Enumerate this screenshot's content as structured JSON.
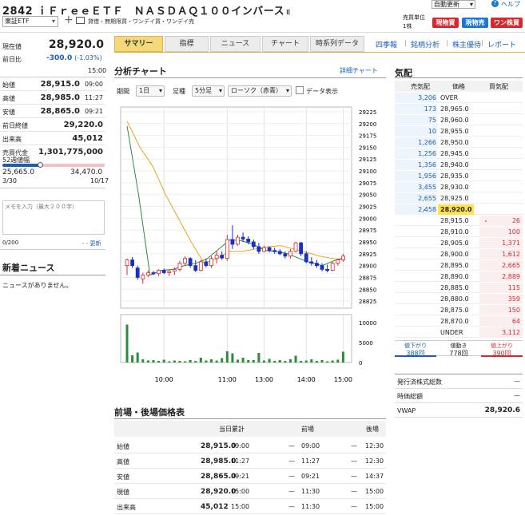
{
  "header": {
    "code": "2842",
    "name": "ｉＦｒｅｅＥＴＦ　ＮＡＳＤＡＱ１００インバース",
    "market_suffix": "E",
    "market_select": "東証ETF",
    "flags": "貸借・無期限買・ワンデイ買・ワンデイ売",
    "auto_update": "自動更新",
    "help": "ヘルプ",
    "trade_unit_label": "売買単位",
    "trade_unit": "1株",
    "buy_cash": "現物買",
    "sell_cash": "現物売",
    "oneday_buy": "ワン株買"
  },
  "tabs": [
    "サマリー",
    "指標",
    "ニュース",
    "チャート",
    "時系列データ",
    "四季報",
    "銘柄分析",
    "株主優待",
    "レポート"
  ],
  "price": {
    "label": "現在値",
    "value": "28,920.0",
    "change_label": "前日比",
    "change": "-300.0",
    "change_pct": "(-1.03%)",
    "time": "15:00"
  },
  "ohlc": [
    {
      "label": "始値",
      "value": "28,915.0",
      "time": "09:00"
    },
    {
      "label": "高値",
      "value": "28,985.0",
      "time": "11:27"
    },
    {
      "label": "安値",
      "value": "28,865.0",
      "time": "09:21"
    }
  ],
  "stats": [
    {
      "label": "前日終値",
      "value": "29,220.0"
    },
    {
      "label": "出来高",
      "value": "45,012"
    },
    {
      "label": "売買代金",
      "value": "1,301,775,000"
    }
  ],
  "range52": {
    "label": "52週値幅",
    "low": "25,665.0",
    "low_date": "3/30",
    "high": "34,470.0",
    "high_date": "10/17",
    "current_fraction": 0.37
  },
  "memo": {
    "placeholder": "メモを入力（最大２００字）",
    "count": "0/200",
    "update": "- - 更新"
  },
  "news": {
    "title": "新着ニュース",
    "empty": "ニュースがありません。"
  },
  "chart": {
    "title": "分析チャート",
    "detail_link": "詳細チャート",
    "period_label": "期間",
    "period": "1日",
    "ashi_label": "足種",
    "ashi": "5分足",
    "candle": "ローソク（赤青）",
    "data_toggle": "データ表示"
  },
  "chart_data": {
    "type": "candlestick",
    "x_ticks": [
      "10:00",
      "11:00",
      "13:00",
      "14:00",
      "15:00"
    ],
    "y_ticks": [
      29225,
      29200,
      29175,
      29150,
      29125,
      29100,
      29075,
      29050,
      29025,
      29000,
      28975,
      28950,
      28925,
      28900,
      28875,
      28850,
      28825
    ],
    "vol_ticks": [
      "10000",
      "5000",
      "0"
    ],
    "ylim": [
      28810,
      29235
    ],
    "candles": [
      {
        "o": 28900,
        "h": 28915,
        "l": 28880,
        "c": 28912
      },
      {
        "o": 28912,
        "h": 28918,
        "l": 28895,
        "c": 28900
      },
      {
        "o": 28895,
        "h": 28900,
        "l": 28870,
        "c": 28875
      },
      {
        "o": 28872,
        "h": 28885,
        "l": 28862,
        "c": 28880
      },
      {
        "o": 28880,
        "h": 28890,
        "l": 28876,
        "c": 28885
      },
      {
        "o": 28885,
        "h": 28889,
        "l": 28880,
        "c": 28883
      },
      {
        "o": 28883,
        "h": 28892,
        "l": 28878,
        "c": 28890
      },
      {
        "o": 28890,
        "h": 28894,
        "l": 28882,
        "c": 28885
      },
      {
        "o": 28885,
        "h": 28892,
        "l": 28878,
        "c": 28888
      },
      {
        "o": 28888,
        "h": 28896,
        "l": 28880,
        "c": 28892
      },
      {
        "o": 28892,
        "h": 28910,
        "l": 28888,
        "c": 28905
      },
      {
        "o": 28905,
        "h": 28920,
        "l": 28900,
        "c": 28915
      },
      {
        "o": 28915,
        "h": 28918,
        "l": 28895,
        "c": 28900
      },
      {
        "o": 28900,
        "h": 28912,
        "l": 28886,
        "c": 28890
      },
      {
        "o": 28890,
        "h": 28912,
        "l": 28888,
        "c": 28908
      },
      {
        "o": 28908,
        "h": 28915,
        "l": 28896,
        "c": 28900
      },
      {
        "o": 28900,
        "h": 28920,
        "l": 28895,
        "c": 28915
      },
      {
        "o": 28915,
        "h": 28930,
        "l": 28905,
        "c": 28922
      },
      {
        "o": 28922,
        "h": 28930,
        "l": 28912,
        "c": 28916
      },
      {
        "o": 28915,
        "h": 28965,
        "l": 28910,
        "c": 28955
      },
      {
        "o": 28955,
        "h": 28985,
        "l": 28935,
        "c": 28945
      },
      {
        "o": 28945,
        "h": 28965,
        "l": 28942,
        "c": 28960
      },
      {
        "o": 28960,
        "h": 28970,
        "l": 28950,
        "c": 28956
      },
      {
        "o": 28956,
        "h": 28962,
        "l": 28945,
        "c": 28950
      },
      {
        "o": 28950,
        "h": 28955,
        "l": 28935,
        "c": 28940
      },
      {
        "o": 28940,
        "h": 28948,
        "l": 28925,
        "c": 28930
      },
      {
        "o": 28930,
        "h": 28942,
        "l": 28928,
        "c": 28938
      },
      {
        "o": 28938,
        "h": 28940,
        "l": 28928,
        "c": 28932
      },
      {
        "o": 28932,
        "h": 28938,
        "l": 28925,
        "c": 28930
      },
      {
        "o": 28930,
        "h": 28935,
        "l": 28922,
        "c": 28925
      },
      {
        "o": 28925,
        "h": 28930,
        "l": 28915,
        "c": 28920
      },
      {
        "o": 28920,
        "h": 28935,
        "l": 28915,
        "c": 28930
      },
      {
        "o": 28930,
        "h": 28950,
        "l": 28928,
        "c": 28948
      },
      {
        "o": 28948,
        "h": 28950,
        "l": 28920,
        "c": 28925
      },
      {
        "o": 28925,
        "h": 28930,
        "l": 28905,
        "c": 28908
      },
      {
        "o": 28908,
        "h": 28918,
        "l": 28900,
        "c": 28905
      },
      {
        "o": 28905,
        "h": 28912,
        "l": 28895,
        "c": 28900
      },
      {
        "o": 28900,
        "h": 28905,
        "l": 28888,
        "c": 28892
      },
      {
        "o": 28892,
        "h": 28902,
        "l": 28886,
        "c": 28890
      },
      {
        "o": 28890,
        "h": 28908,
        "l": 28888,
        "c": 28905
      },
      {
        "o": 28905,
        "h": 28915,
        "l": 28900,
        "c": 28912
      },
      {
        "o": 28912,
        "h": 28925,
        "l": 28908,
        "c": 28920
      }
    ],
    "ma_short": [
      29195,
      29050,
      28880,
      28890,
      28892,
      28900,
      28905,
      28915,
      28935,
      28955,
      28952,
      28945,
      28932,
      28930,
      28925,
      28915,
      28906,
      28900,
      28910,
      28918
    ],
    "ma_long": [
      29205,
      29150,
      29110,
      29050,
      29000,
      28950,
      28905,
      28915,
      28930,
      28930,
      28935,
      28940,
      28942,
      28935,
      28928,
      28920,
      28915,
      28912
    ],
    "volumes": [
      9500,
      1800,
      2500,
      800,
      500,
      600,
      400,
      700,
      300,
      500,
      400,
      300,
      600,
      400,
      1200,
      500,
      800,
      500,
      1100,
      2800,
      2300,
      700,
      1200,
      600,
      600,
      2400,
      500,
      900,
      400,
      600,
      400,
      800,
      1700,
      400,
      500,
      800,
      400,
      600,
      300,
      500,
      700,
      2700
    ],
    "colors": {
      "up": "#d9282d",
      "down": "#1a2fc4",
      "ma_short": "#2c8c3c",
      "ma_long": "#f0a020",
      "volume": "#2c8c3c"
    }
  },
  "price_table": {
    "title": "前場・後場価格表",
    "headers": [
      "当日累計",
      "前場",
      "後場"
    ],
    "rows": [
      {
        "label": "始値",
        "total": "28,915.0",
        "total_time": "09:00",
        "am": "—",
        "am_time": "09:00",
        "pm": "—",
        "pm_time": "12:30"
      },
      {
        "label": "高値",
        "total": "28,985.0",
        "total_time": "11:27",
        "am": "—",
        "am_time": "11:27",
        "pm": "—",
        "pm_time": "12:30"
      },
      {
        "label": "安値",
        "total": "28,865.0",
        "total_time": "09:21",
        "am": "—",
        "am_time": "09:21",
        "pm": "—",
        "pm_time": "14:37"
      },
      {
        "label": "現値",
        "total": "28,920.0",
        "total_time": "15:00",
        "am": "—",
        "am_time": "11:30",
        "pm": "—",
        "pm_time": "15:00"
      },
      {
        "label": "出来高",
        "total": "45,012",
        "total_time": "15:00",
        "am": "—",
        "am_time": "11:30",
        "pm": "—",
        "pm_time": "15:00"
      }
    ]
  },
  "board": {
    "title": "気配",
    "headers": [
      "売気配",
      "価格",
      "買気配"
    ],
    "rows": [
      {
        "sell": "3,206",
        "price": "OVER",
        "buy": ""
      },
      {
        "sell": "173",
        "price": "28,965.0",
        "buy": ""
      },
      {
        "sell": "75",
        "price": "28,960.0",
        "buy": ""
      },
      {
        "sell": "10",
        "price": "28,955.0",
        "buy": ""
      },
      {
        "sell": "1,266",
        "price": "28,950.0",
        "buy": ""
      },
      {
        "sell": "1,256",
        "price": "28,945.0",
        "buy": ""
      },
      {
        "sell": "1,356",
        "price": "28,940.0",
        "buy": ""
      },
      {
        "sell": "1,956",
        "price": "28,935.0",
        "buy": ""
      },
      {
        "sell": "3,455",
        "price": "28,930.0",
        "buy": ""
      },
      {
        "sell": "2,655",
        "price": "28,925.0",
        "buy": ""
      },
      {
        "sell": "2,458",
        "price": "28,920.0",
        "buy": "",
        "highlight": true,
        "mark": "・"
      },
      {
        "sell": "",
        "price": "28,915.0",
        "buy": "26",
        "mark": "・"
      },
      {
        "sell": "",
        "price": "28,910.0",
        "buy": "100"
      },
      {
        "sell": "",
        "price": "28,905.0",
        "buy": "1,371"
      },
      {
        "sell": "",
        "price": "28,900.0",
        "buy": "1,612"
      },
      {
        "sell": "",
        "price": "28,895.0",
        "buy": "2,665"
      },
      {
        "sell": "",
        "price": "28,890.0",
        "buy": "2,889"
      },
      {
        "sell": "",
        "price": "28,885.0",
        "buy": "115"
      },
      {
        "sell": "",
        "price": "28,880.0",
        "buy": "359"
      },
      {
        "sell": "",
        "price": "28,875.0",
        "buy": "150"
      },
      {
        "sell": "",
        "price": "28,870.0",
        "buy": "64"
      },
      {
        "sell": "",
        "price": "UNDER",
        "buy": "3,112"
      }
    ],
    "footer": {
      "down_label": "値下がり",
      "down_count": "388回",
      "mid_label": "値動き",
      "mid_count": "778回",
      "up_label": "値上がり",
      "up_count": "390回"
    }
  },
  "info": [
    {
      "label": "発行済株式総数",
      "value": "—"
    },
    {
      "label": "時価総額",
      "value": "—"
    },
    {
      "label": "VWAP",
      "value": "28,920.6"
    }
  ]
}
